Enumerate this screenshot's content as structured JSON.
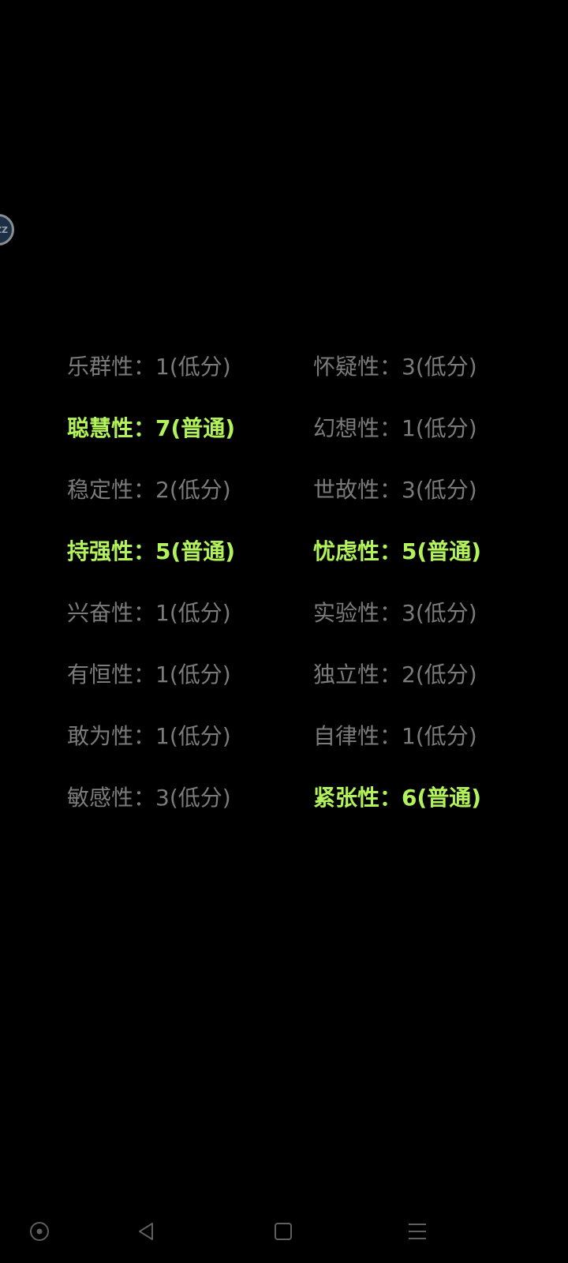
{
  "floating_badge": {
    "text": "ZZ"
  },
  "scores": [
    {
      "left": {
        "text": "乐群性：1(低分)",
        "level": "low"
      },
      "right": {
        "text": "怀疑性：3(低分)",
        "level": "low"
      }
    },
    {
      "left": {
        "text": "聪慧性：7(普通)",
        "level": "normal"
      },
      "right": {
        "text": "幻想性：1(低分)",
        "level": "low"
      }
    },
    {
      "left": {
        "text": "稳定性：2(低分)",
        "level": "low"
      },
      "right": {
        "text": "世故性：3(低分)",
        "level": "low"
      }
    },
    {
      "left": {
        "text": "持强性：5(普通)",
        "level": "normal"
      },
      "right": {
        "text": "忧虑性：5(普通)",
        "level": "normal"
      }
    },
    {
      "left": {
        "text": "兴奋性：1(低分)",
        "level": "low"
      },
      "right": {
        "text": "实验性：3(低分)",
        "level": "low"
      }
    },
    {
      "left": {
        "text": "有恒性：1(低分)",
        "level": "low"
      },
      "right": {
        "text": "独立性：2(低分)",
        "level": "low"
      }
    },
    {
      "left": {
        "text": "敢为性：1(低分)",
        "level": "low"
      },
      "right": {
        "text": "自律性：1(低分)",
        "level": "low"
      }
    },
    {
      "left": {
        "text": "敏感性：3(低分)",
        "level": "low"
      },
      "right": {
        "text": "紧张性：6(普通)",
        "level": "normal"
      }
    }
  ],
  "colors": {
    "background": "#000000",
    "low_text": "#7b7b7b",
    "normal_text": "#b2f25a",
    "nav_icon": "#5f5f5f"
  },
  "navbar": {
    "icons": [
      "assistant-dot-icon",
      "back-triangle-icon",
      "home-square-icon",
      "menu-lines-icon"
    ]
  }
}
